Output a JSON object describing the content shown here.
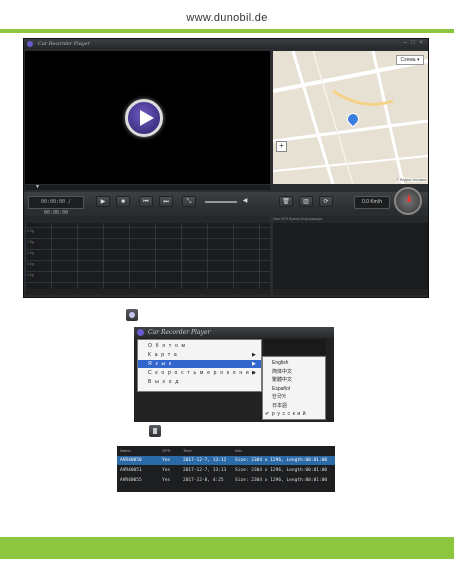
{
  "site": {
    "url": "www.dunobil.de"
  },
  "app": {
    "title": "Car Recorder Player",
    "timecode": "00:00:00 / 00:00:00",
    "speed": "0.0 Km/h",
    "map_lang_button": "Схема ▾",
    "map_copyright": "© Яндекс Условия",
    "graph_labels": [
      "2.0g",
      "1.5g",
      "1.0g",
      "0.5g",
      "0.0g"
    ],
    "filelist_header": "Имя   GPS   Время   Информация"
  },
  "menu": {
    "title": "Car Recorder Player",
    "items": [
      {
        "label": "О б о т о м",
        "has_sub": false
      },
      {
        "label": "К а р т а",
        "has_sub": true
      },
      {
        "label": "Я з ы к",
        "has_sub": true,
        "selected": true
      },
      {
        "label": "С к о р о с т ь м е р о к о н и ч",
        "has_sub": true
      },
      {
        "label": "В ы х о д",
        "has_sub": false
      }
    ],
    "languages": [
      {
        "label": "English",
        "checked": false
      },
      {
        "label": "简体中文",
        "checked": false
      },
      {
        "label": "繁體中文",
        "checked": false
      },
      {
        "label": "Español",
        "checked": false
      },
      {
        "label": "한국어",
        "checked": false
      },
      {
        "label": "日本語",
        "checked": false
      },
      {
        "label": "р у с с к и й",
        "checked": true
      }
    ]
  },
  "table": {
    "headers": [
      "Name",
      "GPS",
      "Time",
      "Info"
    ],
    "rows": [
      {
        "name": "AVR40050",
        "gps": "Yes",
        "time": "2017-12-7, 13:12",
        "info": "Size: 2304 x 1296, Length:00:01:00",
        "selected": true
      },
      {
        "name": "AVR40051",
        "gps": "Yes",
        "time": "2017-12-7, 13:13",
        "info": "Size: 2304 x 1296, Length:00:01:00",
        "selected": false
      },
      {
        "name": "AVR40055",
        "gps": "Yes",
        "time": "2017-12-8, 4:25",
        "info": "Size: 2304 x 1296, Length:00:01:00",
        "selected": false
      }
    ]
  },
  "colors": {
    "accent_green": "#8cc63f",
    "selection_blue": "#3366cc"
  }
}
